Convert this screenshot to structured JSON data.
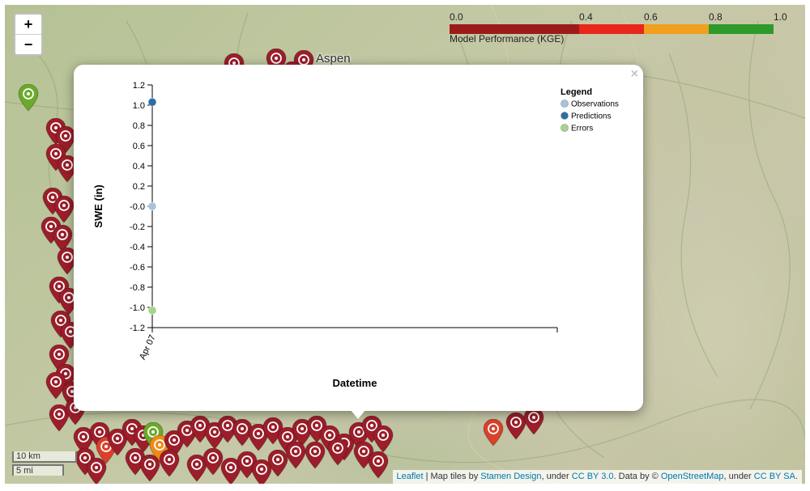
{
  "map": {
    "town_label": "Aspen",
    "zoom_in_label": "+",
    "zoom_out_label": "−",
    "scale_km": "10 km",
    "scale_mi": "5 mi",
    "attribution": {
      "leaflet": "Leaflet",
      "sep1": " | Map tiles by ",
      "stamen": "Stamen Design",
      "sep2": ", under ",
      "ccby": "CC BY 3.0",
      "sep3": ". Data by © ",
      "osm": "OpenStreetMap",
      "sep4": ", under ",
      "ccbysa": "CC BY SA",
      "end": "."
    },
    "colorbar": {
      "title": "Model Performance (KGE)",
      "ticks": [
        "0.0",
        "0.4",
        "0.6",
        "0.8",
        "1.0"
      ],
      "segments": [
        {
          "from": 0.0,
          "to": 0.4,
          "color": "#9b1b1b"
        },
        {
          "from": 0.4,
          "to": 0.6,
          "color": "#e8261b"
        },
        {
          "from": 0.6,
          "to": 0.8,
          "color": "#f0a01e"
        },
        {
          "from": 0.8,
          "to": 1.0,
          "color": "#2e9a2a"
        }
      ]
    },
    "marker_colors": {
      "red": "#9c1e2a",
      "orange_red": "#d9412b",
      "orange": "#ef8a17",
      "green": "#6aaa2a"
    }
  },
  "popup": {
    "close_label": "×"
  },
  "chart_data": {
    "type": "scatter",
    "xlabel": "Datetime",
    "ylabel": "SWE (in)",
    "x_ticks": [
      "Apr 07"
    ],
    "y_ticks": [
      "1.2",
      "1.0",
      "0.8",
      "0.6",
      "0.4",
      "0.2",
      "-0.0",
      "-0.2",
      "-0.4",
      "-0.6",
      "-0.8",
      "-1.0",
      "-1.2"
    ],
    "ylim": [
      -1.2,
      1.2
    ],
    "legend_title": "Legend",
    "legend_position": "top-right",
    "series": [
      {
        "name": "Observations",
        "color": "#a7c3dc",
        "points": [
          {
            "x": "Apr 07",
            "y": 0.0
          }
        ]
      },
      {
        "name": "Predictions",
        "color": "#2b6ea8",
        "points": [
          {
            "x": "Apr 07",
            "y": 1.03
          }
        ]
      },
      {
        "name": "Errors",
        "color": "#a6d489",
        "points": [
          {
            "x": "Apr 07",
            "y": -1.03
          }
        ]
      }
    ]
  }
}
